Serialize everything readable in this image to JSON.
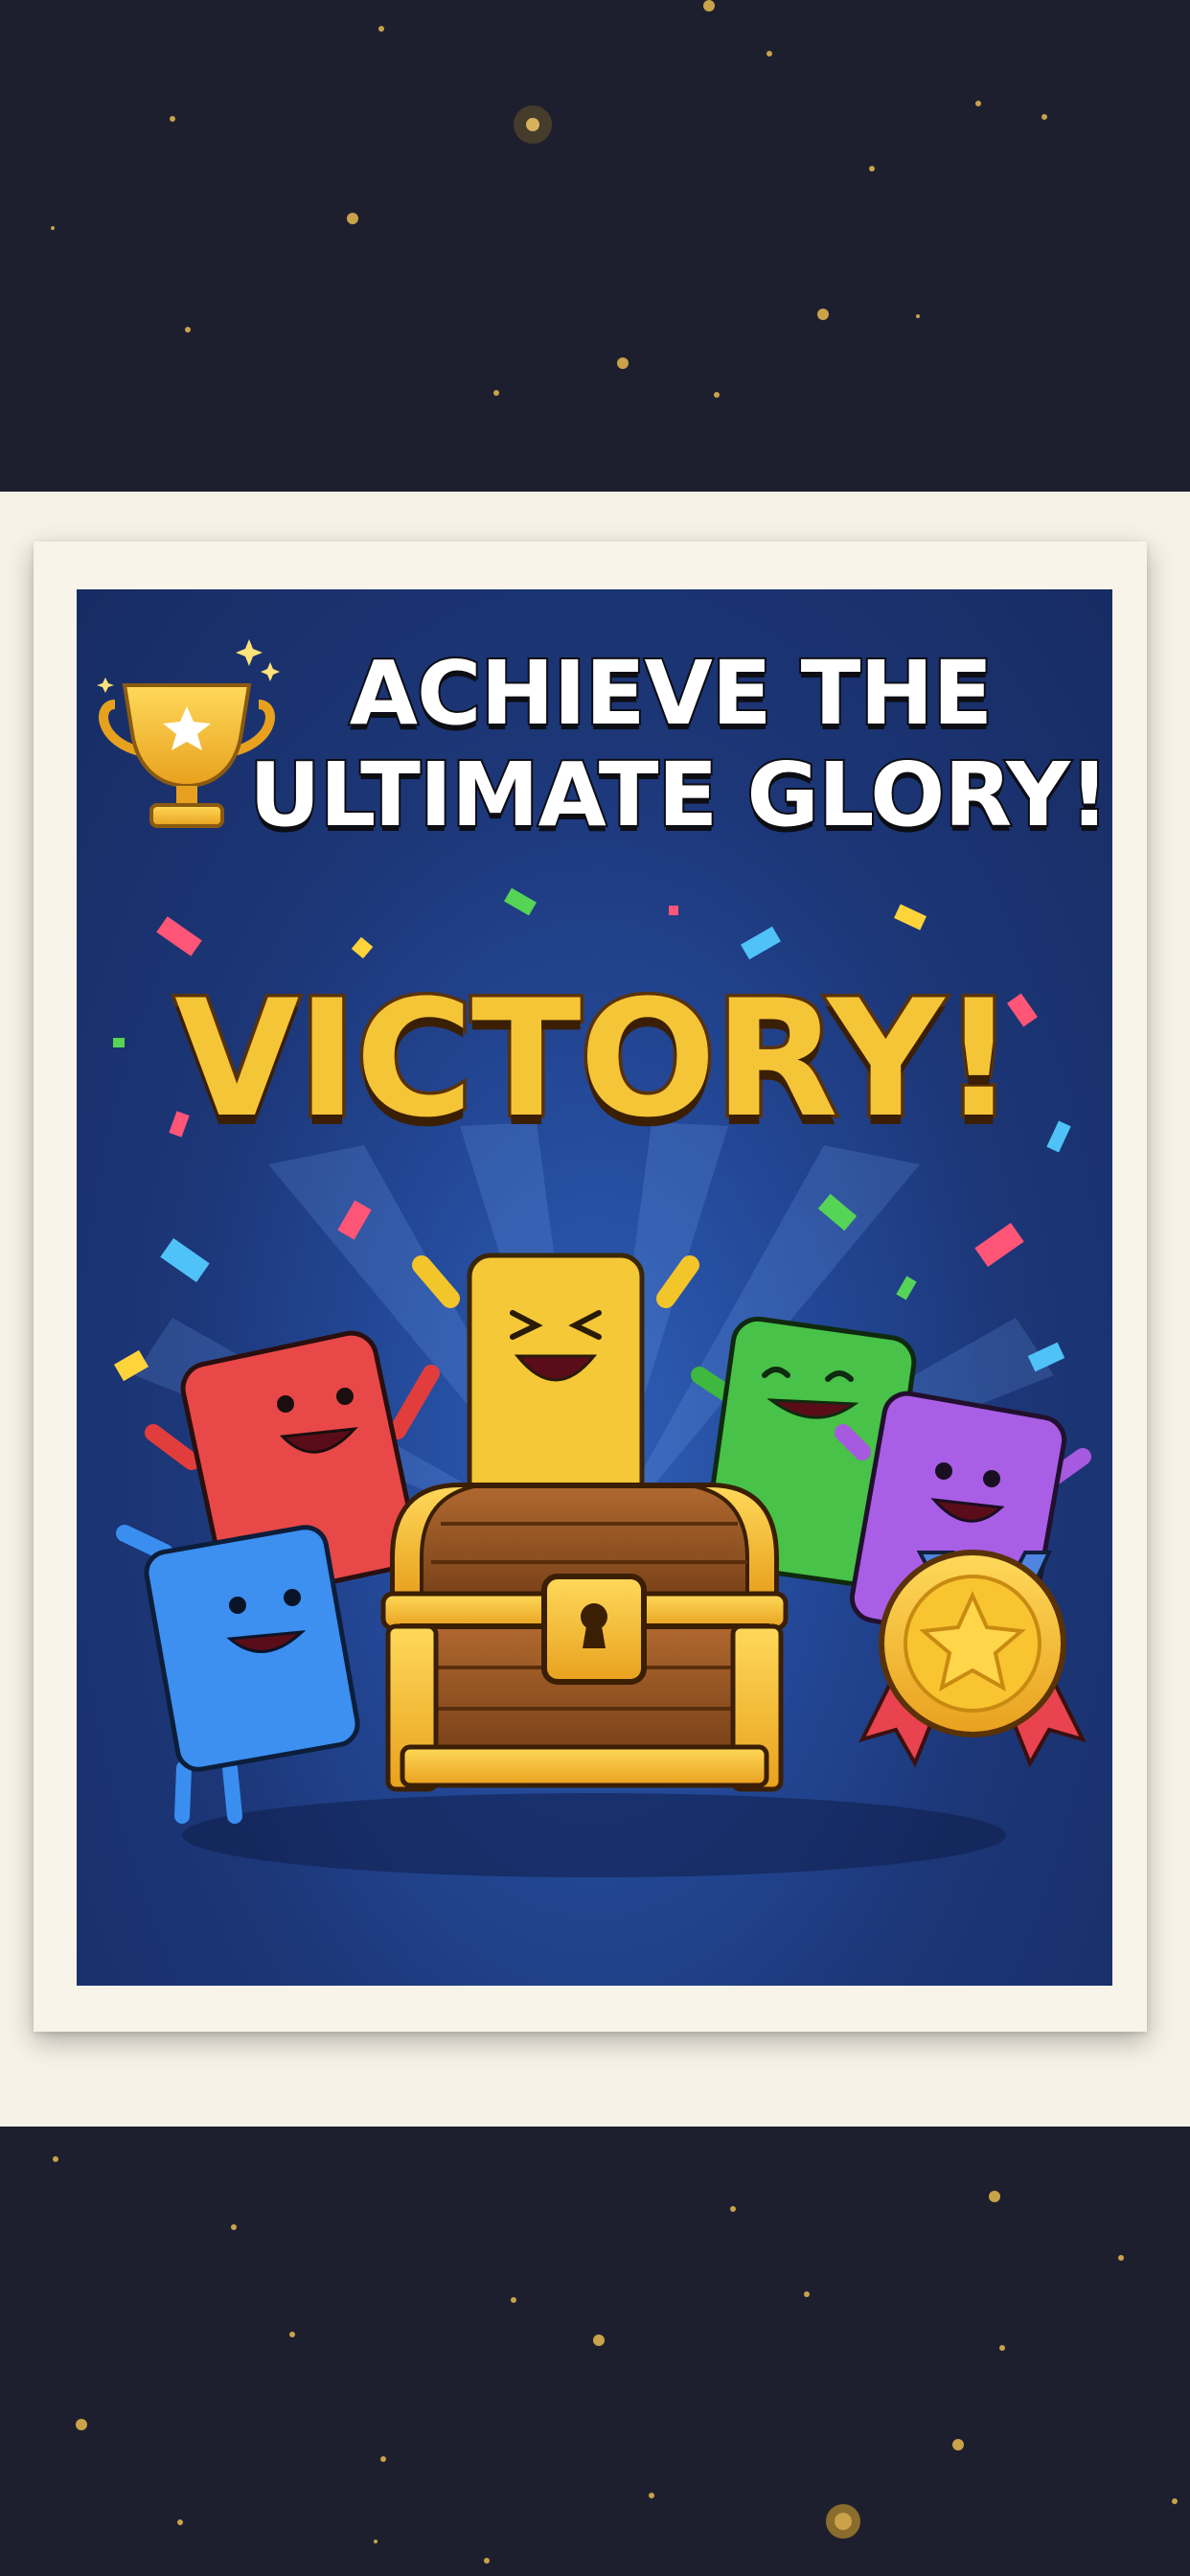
{
  "poster": {
    "headline_line1": "ACHIEVE THE",
    "headline_line2": "ULTIMATE GLORY!",
    "victory_text": "VICTORY!"
  },
  "icons": {
    "trophy": "trophy-icon",
    "treasure_chest": "treasure-chest-icon",
    "medal": "star-medal-icon"
  },
  "characters": [
    "red-block-character",
    "blue-block-character",
    "yellow-block-character",
    "green-block-character",
    "purple-block-character"
  ],
  "colors": {
    "page_background": "#1e1f2e",
    "poster_border": "#f8f4ea",
    "poster_background": "#1c3677",
    "headline": "#ffffff",
    "victory": "#f5c538",
    "gold": "#f2b62a"
  }
}
